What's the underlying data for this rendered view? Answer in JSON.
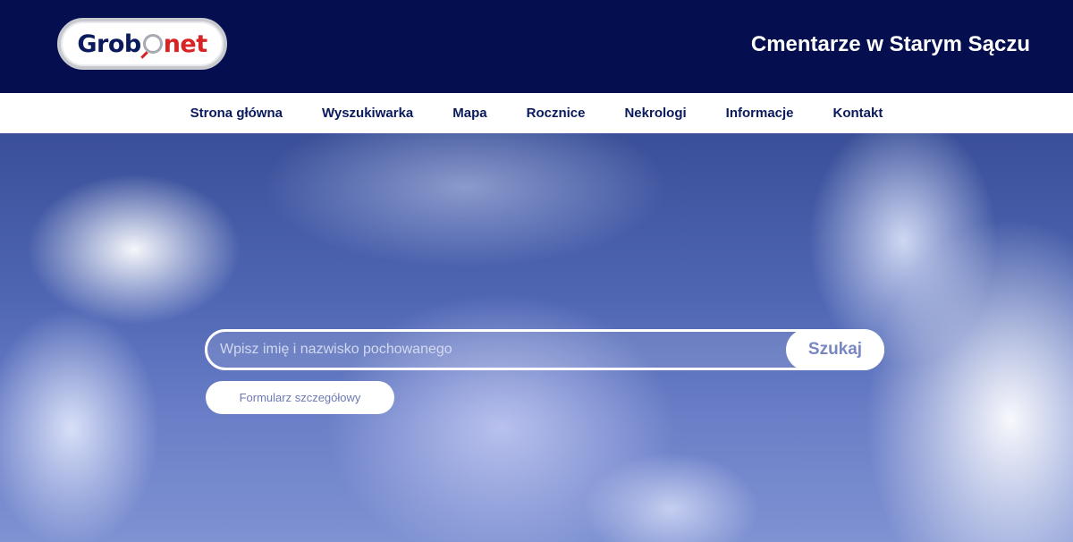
{
  "header": {
    "logo": {
      "part1": "Grob",
      "part2": "net"
    },
    "title": "Cmentarze w Starym Sączu"
  },
  "nav": {
    "items": [
      {
        "label": "Strona główna"
      },
      {
        "label": "Wyszukiwarka"
      },
      {
        "label": "Mapa"
      },
      {
        "label": "Rocznice"
      },
      {
        "label": "Nekrologi"
      },
      {
        "label": "Informacje"
      },
      {
        "label": "Kontakt"
      }
    ]
  },
  "search": {
    "placeholder": "Wpisz imię i nazwisko pochowanego",
    "value": "",
    "button_label": "Szukaj",
    "detail_form_label": "Formularz szczegółowy"
  },
  "colors": {
    "header_bg": "#050f4f",
    "nav_text": "#0a1a5c",
    "logo_red": "#d82424",
    "button_text": "#7887c2"
  }
}
